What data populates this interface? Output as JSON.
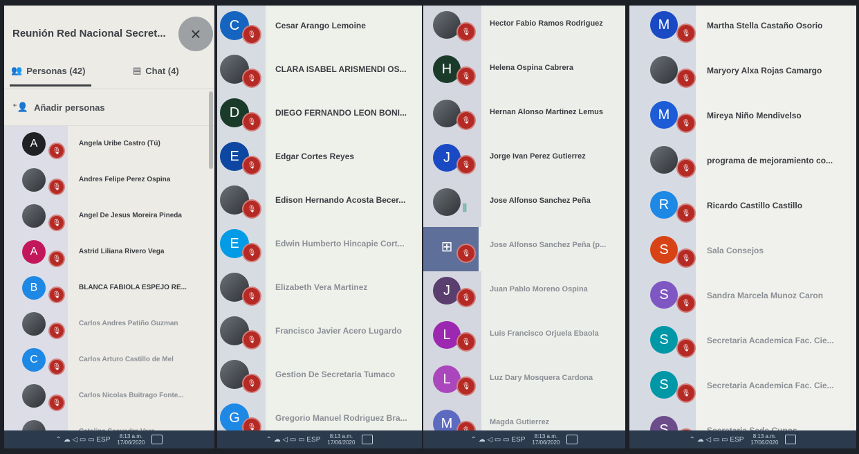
{
  "meeting": {
    "title": "Reunión Red Nacional Secret...",
    "close_icon": "×",
    "tab_people": "Personas (42)",
    "tab_chat": "Chat (4)",
    "add_people": "Añadir personas"
  },
  "panel1": [
    {
      "initial": "A",
      "color": "#202124",
      "name": "Angela Uribe Castro (Tú)"
    },
    {
      "initial": "",
      "color": "#c7c7c2",
      "name": "Andres Felipe Perez Ospina",
      "photo": true
    },
    {
      "initial": "",
      "color": "#5b5f66",
      "name": "Angel De Jesus Moreira Pineda",
      "photo": true
    },
    {
      "initial": "A",
      "color": "#c2185b",
      "name": "Astrid Liliana Rivero Vega"
    },
    {
      "initial": "B",
      "color": "#1e88e5",
      "name": "BLANCA FABIOLA ESPEJO RE..."
    },
    {
      "initial": "",
      "color": "#5a4c45",
      "name": "Carlos Andres Patiño Guzman",
      "photo": true
    },
    {
      "initial": "C",
      "color": "#1e88e5",
      "name": "Carlos Arturo Castillo de Mel"
    },
    {
      "initial": "",
      "color": "#8d8580",
      "name": "Carlos Nicolas Buitrago Fonte...",
      "photo": true
    },
    {
      "initial": "",
      "color": "#e8e8e4",
      "name": "Catalina Saavedra Vera",
      "photo": true
    }
  ],
  "panel2": [
    {
      "initial": "C",
      "color": "#1565c0",
      "name": "Cesar Arango Lemoine"
    },
    {
      "initial": "",
      "color": "#44586e",
      "name": "CLARA ISABEL ARISMENDI OS...",
      "photo": true
    },
    {
      "initial": "D",
      "color": "#1b3b2a",
      "name": "DIEGO FERNANDO LEON BONI..."
    },
    {
      "initial": "E",
      "color": "#0d47a1",
      "name": "Edgar Cortes Reyes"
    },
    {
      "initial": "",
      "color": "#7a5555",
      "name": "Edison Hernando Acosta Becer...",
      "photo": true
    },
    {
      "initial": "E",
      "color": "#039be5",
      "name": "Edwin Humberto Hincapie Cort..."
    },
    {
      "initial": "",
      "color": "#8a7d6e",
      "name": "Elizabeth Vera Martinez",
      "photo": true
    },
    {
      "initial": "",
      "color": "#a29a90",
      "name": "Francisco Javier Acero Lugardo",
      "photo": true
    },
    {
      "initial": "",
      "color": "#4d7e8a",
      "name": "Gestion De Secretaria Tumaco",
      "photo": true
    },
    {
      "initial": "G",
      "color": "#1e88e5",
      "name": "Gregorio Manuel Rodriguez Bra..."
    }
  ],
  "panel3": [
    {
      "initial": "",
      "color": "#3d3833",
      "name": "Hector Fabio Ramos Rodriguez",
      "photo": true
    },
    {
      "initial": "H",
      "color": "#1b3b2a",
      "name": "Helena Ospina Cabrera"
    },
    {
      "initial": "",
      "color": "#d9d9d4",
      "name": "Hernan Alonso Martinez Lemus",
      "photo": true
    },
    {
      "initial": "J",
      "color": "#1a49c4",
      "name": "Jorge Ivan Perez Gutierrez"
    },
    {
      "initial": "",
      "color": "#4a5566",
      "name": "Jose Alfonso Sanchez Peña",
      "photo": true,
      "speaking": true
    },
    {
      "initial": "⊞",
      "color": "#5e6f99",
      "name": "Jose Alfonso Sanchez Peña (p...",
      "highlight": true
    },
    {
      "initial": "J",
      "color": "#5a3e6e",
      "name": "Juan Pablo Moreno Ospina"
    },
    {
      "initial": "L",
      "color": "#9c27b0",
      "name": "Luis Francisco Orjuela Ebaola"
    },
    {
      "initial": "L",
      "color": "#ab47bc",
      "name": "Luz Dary Mosquera Cardona"
    },
    {
      "initial": "M",
      "color": "#5c6bc0",
      "name": "Magda Gutierrez"
    }
  ],
  "panel4": [
    {
      "initial": "M",
      "color": "#1a49c4",
      "name": "Martha Stella Castaño Osorio"
    },
    {
      "initial": "",
      "color": "#2d2f33",
      "name": "Maryory Alxa Rojas Camargo",
      "photo": true
    },
    {
      "initial": "M",
      "color": "#1e5bd6",
      "name": "Mireya Niño Mendivelso"
    },
    {
      "initial": "",
      "color": "#e9e9e6",
      "name": "programa de mejoramiento co...",
      "photo": true
    },
    {
      "initial": "R",
      "color": "#1e88e5",
      "name": "Ricardo Castillo Castillo"
    },
    {
      "initial": "S",
      "color": "#d84315",
      "name": "Sala Consejos"
    },
    {
      "initial": "S",
      "color": "#7e57c2",
      "name": "Sandra Marcela Munoz Caron"
    },
    {
      "initial": "S",
      "color": "#0097a7",
      "name": "Secretaria Academica Fac. Cie..."
    },
    {
      "initial": "S",
      "color": "#0097a7",
      "name": "Secretaria Academica Fac. Cie..."
    },
    {
      "initial": "S",
      "color": "#6d4c8a",
      "name": "Secretaria Sede Cupos"
    }
  ],
  "taskbar": {
    "time": "8:13 a.m.",
    "date": "17/06/2020"
  },
  "icons": {
    "people": "people-icon",
    "chat": "chat-icon",
    "add": "add-person-icon",
    "mic": "mic-off-icon"
  }
}
